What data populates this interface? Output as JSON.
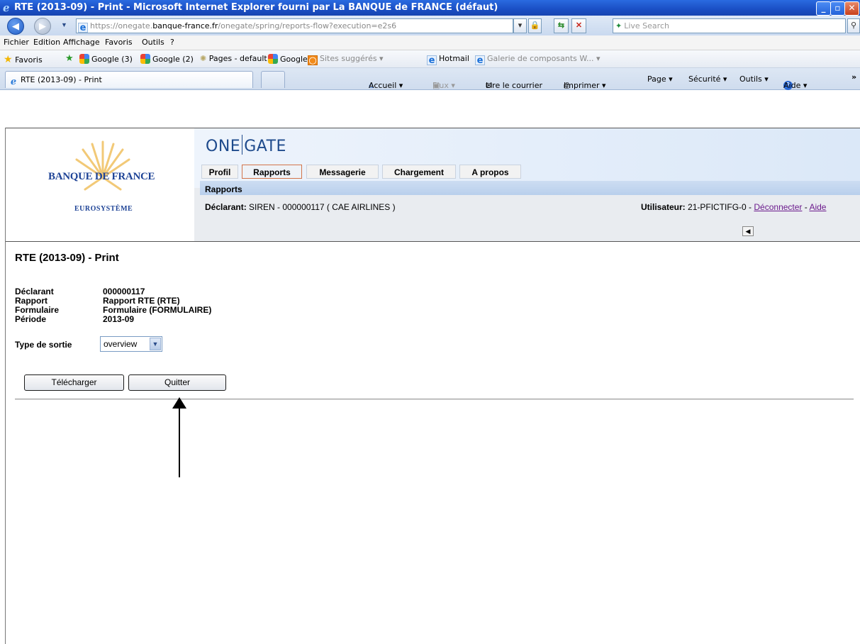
{
  "window": {
    "title": "RTE (2013-09) - Print - Microsoft Internet Explorer fourni par La BANQUE de FRANCE (défaut)",
    "controls": [
      "_",
      "▫",
      "✕"
    ]
  },
  "address_bar": {
    "url_prefix": "https://onegate.",
    "url_domain": "banque-france.fr",
    "url_path": "/onegate/spring/reports-flow?execution=e2s6",
    "search_placeholder": "Live Search"
  },
  "menu": [
    "Fichier",
    "Edition",
    "Affichage",
    "Favoris",
    "Outils",
    "?"
  ],
  "favorites": {
    "label": "Favoris",
    "items": [
      "Google (3)",
      "Google (2)",
      "Pages - default",
      "Google",
      "Sites suggérés ▾",
      "Hotmail",
      "Galerie de composants W... ▾"
    ]
  },
  "tabs": {
    "active": "RTE (2013-09) - Print"
  },
  "command_bar": [
    "Accueil ▾",
    "Flux ▾",
    "Lire le courrier",
    "Imprimer ▾",
    "Page ▾",
    "Sécurité ▾",
    "Outils ▾",
    "Aide ▾",
    "»"
  ],
  "site": {
    "logo_name": "BANQUE DE FRANCE",
    "logo_sub": "EUROSYSTÈME",
    "brand_left": "ONE",
    "brand_right": "GATE",
    "nav_tabs": [
      "Profil",
      "Rapports",
      "Messagerie",
      "Chargement",
      "A propos"
    ],
    "active_tab": "Rapports",
    "subnav": "Rapports",
    "declarant_label": "Déclarant:",
    "declarant_value": "SIREN - 000000117 ( CAE AIRLINES )",
    "user_label": "Utilisateur:",
    "user_value": "21-PFICTIFG-0 -",
    "logout": "Déconnecter",
    "dash": "-",
    "help": "Aide"
  },
  "content": {
    "title": "RTE (2013-09) - Print",
    "fields": [
      {
        "label": "Déclarant",
        "value": "000000117"
      },
      {
        "label": "Rapport",
        "value": "Rapport RTE (RTE)"
      },
      {
        "label": "Formulaire",
        "value": "Formulaire (FORMULAIRE)"
      },
      {
        "label": "Période",
        "value": "2013-09"
      }
    ],
    "output_label": "Type de sortie",
    "output_value": "overview",
    "download_button": "Télécharger",
    "quit_button": "Quitter"
  },
  "colors": {
    "titlebar": "#1a4fc4",
    "brand_blue": "#1e4a8c",
    "active_tab_border": "#d2744a",
    "link_visited": "#6b1a8c"
  }
}
